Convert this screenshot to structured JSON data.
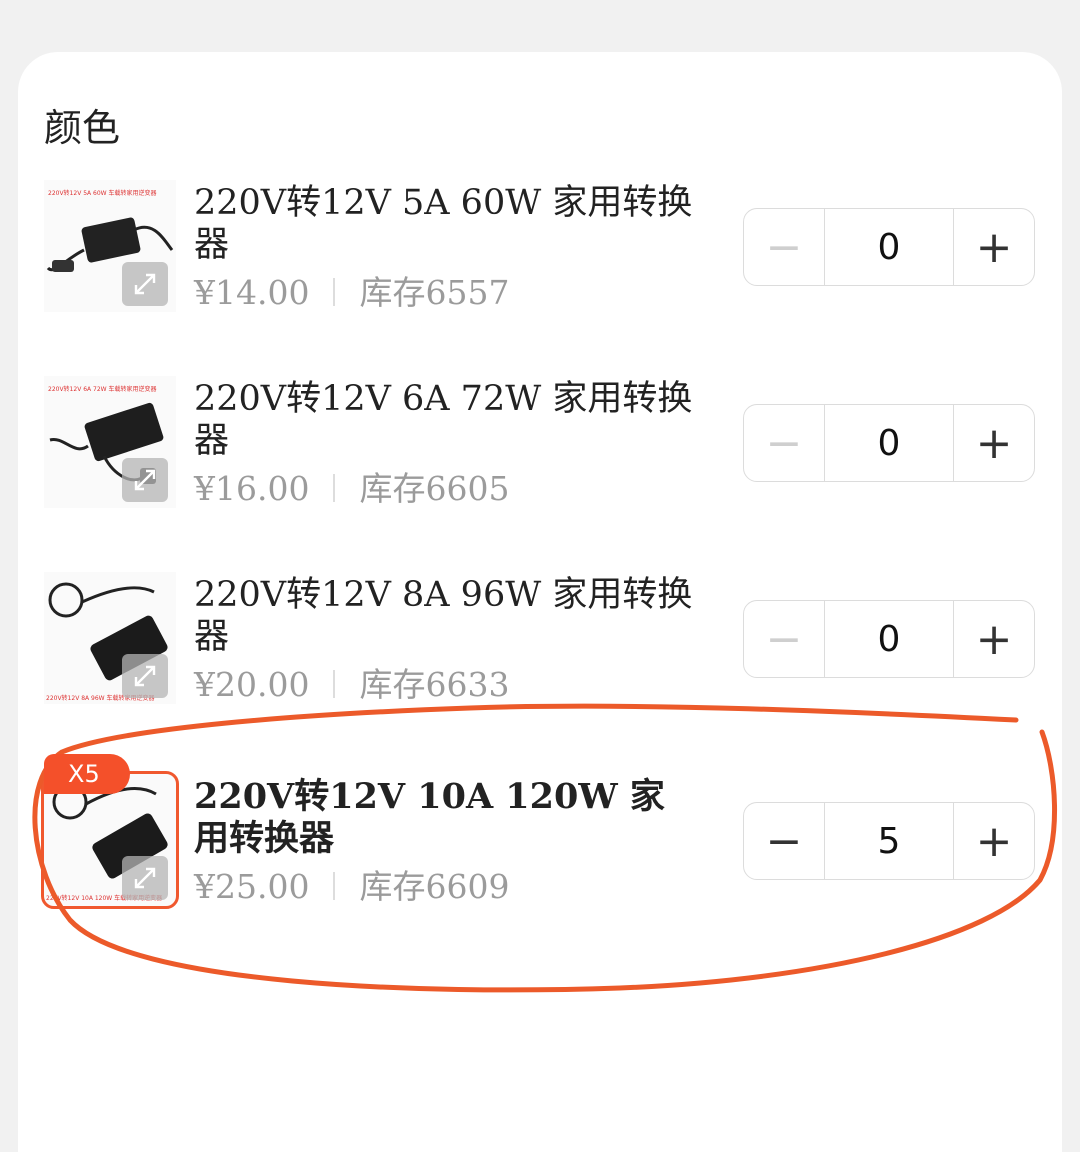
{
  "section": {
    "title": "颜色"
  },
  "items": [
    {
      "name": "220V转12V 5A 60W 家用转换器",
      "price": "¥14.00",
      "stock": "库存6557",
      "quantity": "0",
      "thumb_caption": "220V转12V 5A 60W 车载转家用逆变器",
      "selected": false
    },
    {
      "name": "220V转12V 6A 72W 家用转换器",
      "price": "¥16.00",
      "stock": "库存6605",
      "quantity": "0",
      "thumb_caption": "220V转12V 6A 72W 车载转家用逆变器",
      "selected": false
    },
    {
      "name": "220V转12V 8A 96W 家用转换器",
      "price": "¥20.00",
      "stock": "库存6633",
      "quantity": "0",
      "thumb_caption": "220V转12V 8A 96W 车载转家用逆变器",
      "selected": false
    },
    {
      "name": "220V转12V 10A 120W 家用转换器",
      "price": "¥25.00",
      "stock": "库存6609",
      "quantity": "5",
      "badge": "X5",
      "thumb_caption": "220V转12V 10A 120W 车载转家用逆变器",
      "selected": true
    }
  ],
  "stepper": {
    "minus": "−",
    "plus": "+"
  },
  "colors": {
    "accent": "#f4502a",
    "annotation": "#ec5a2a"
  }
}
